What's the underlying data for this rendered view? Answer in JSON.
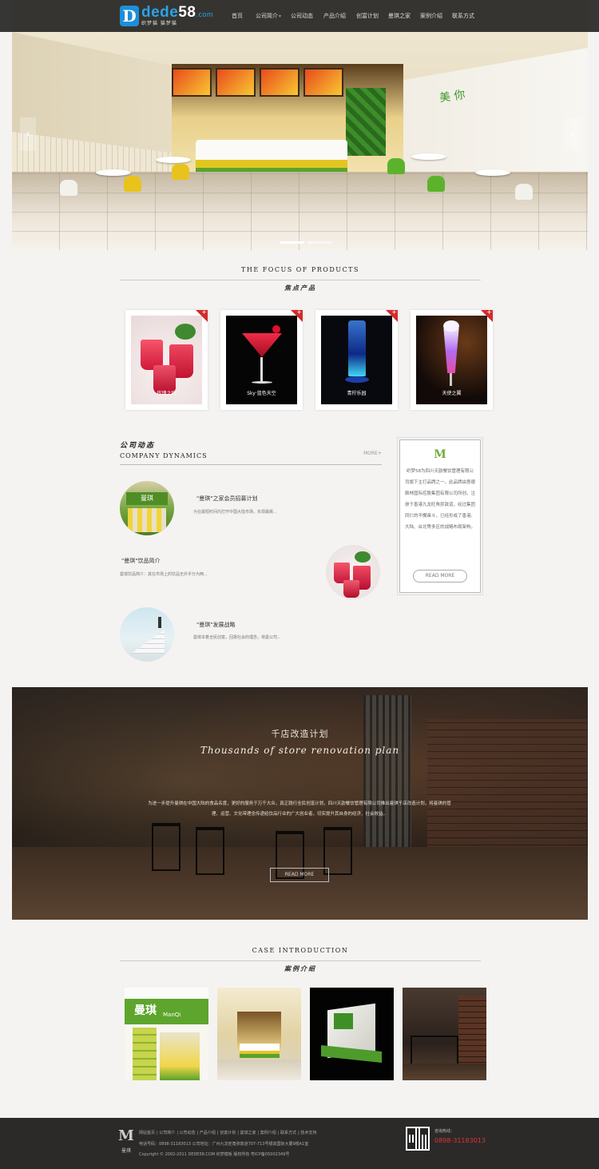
{
  "header": {
    "logo_main": "dede",
    "logo_num": "58",
    "logo_domain": ".com",
    "logo_sub": "织梦猫 猫梦猫",
    "nav": [
      {
        "label": "首页"
      },
      {
        "label": "公司简介"
      },
      {
        "label": "公司动态"
      },
      {
        "label": "产品介绍"
      },
      {
        "label": "创富计划"
      },
      {
        "label": "曼琪之家"
      },
      {
        "label": "案例介绍"
      },
      {
        "label": "联系方式"
      }
    ]
  },
  "banner": {
    "wall_text": "美 你",
    "prev_icon": "‹",
    "next_icon": "›"
  },
  "products_section": {
    "title_en": "THE FOCUS OF PRODUCTS",
    "title_cn": "焦点产品",
    "items": [
      {
        "caption": "玫瑰之约",
        "icon": "plus-icon"
      },
      {
        "caption": "Sky·蓝色天空",
        "icon": "plus-icon"
      },
      {
        "caption": "青柠乐园",
        "icon": "plus-icon"
      },
      {
        "caption": "天使之翼",
        "icon": "plus-icon"
      }
    ],
    "plus": "+"
  },
  "dynamics": {
    "title_cn": "公司动态",
    "title_en": "COMPANY DYNAMICS",
    "more": "MORE+",
    "news": [
      {
        "title": "\"曼琪\"之家会员招募计划",
        "desc": "为在最短时间内打开中国大陆市场，实现最跳..."
      },
      {
        "title": "\"曼琪\"饮品简介",
        "desc": "曼琪饮品简介：其在市场上的饮品无外乎分为两..."
      },
      {
        "title": "\"曼琪\"发展战略",
        "desc": "曼琪本着全民创富，回报社会的理念，将曼公司..."
      }
    ]
  },
  "aside": {
    "mark": "M",
    "text": "织梦58为四川天韵餐饮管理有限公司旗下主打品牌之一，此品牌由意德赖林国际控股集团有限公司所创，注册于香港九龙旺角弥敦道，经过集团同仁的不懈奋斗，已经形成了香港、大陆、台北等多区的战略布局架构。",
    "button": "READ MORE"
  },
  "plan": {
    "title_cn": "千店改造计划",
    "title_en": "Thousands of store renovation plan",
    "text": "为进一步提升曼琪在中国大陆的食品名度，更好的服务于万千大众，真正践行全民创富计划，四川天韵餐饮管理有限公司推出曼琪千店改造计划，将曼琪的管理、运营、文化带理念传递给饮品行业的广大创业者，切实提升其自身的经济、社会效益。",
    "button": "READ MORE"
  },
  "cases": {
    "title_en": "CASE INTRODUCTION",
    "title_cn": "案例介绍",
    "shop_sign": "曼琪",
    "shop_sign_en": "ManQi"
  },
  "footer": {
    "logo_mark": "M",
    "logo_cn": "曼琪",
    "links": [
      "网站首页",
      "公司简介",
      "公司动态",
      "产品介绍",
      "创富计划",
      "曼琪之家",
      "案例介绍",
      "联系方式",
      "技术支持"
    ],
    "contact": "电话号码：0898-31183013  公司地址：广州九龙旺角弥敦道707-713号银高国际大厦9楼A1室",
    "copyright": "Copyright © 2002-2011 DEDE58.COM 织梦模板 版权所有 粤ICP备05002349号",
    "hotline_label": "咨询热线：",
    "hotline": "0898-31183013"
  }
}
